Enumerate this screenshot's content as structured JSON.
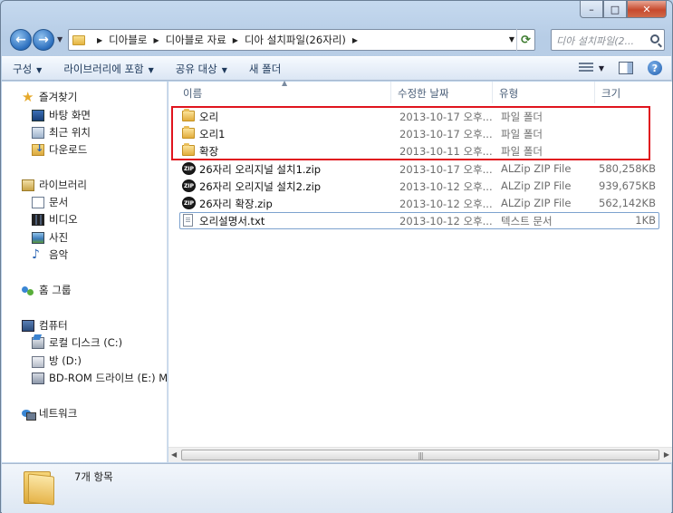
{
  "window": {
    "caption_buttons": {
      "minimize": "–",
      "maximize": "□",
      "close": "✕"
    }
  },
  "address_bar": {
    "breadcrumbs": [
      "디아블로",
      "디아블로 자료",
      "디아 설치파일(26자리)"
    ],
    "search_placeholder": "디아 설치파일(2..."
  },
  "toolbar": {
    "items": [
      {
        "label": "구성",
        "dropdown": true
      },
      {
        "label": "라이브러리에 포함",
        "dropdown": true
      },
      {
        "label": "공유 대상",
        "dropdown": true
      },
      {
        "label": "새 폴더",
        "dropdown": false
      }
    ]
  },
  "nav_pane": {
    "favorites": {
      "label": "즐겨찾기",
      "items": [
        "바탕 화면",
        "최근 위치",
        "다운로드"
      ]
    },
    "libraries": {
      "label": "라이브러리",
      "items": [
        "문서",
        "비디오",
        "사진",
        "음악"
      ]
    },
    "homegroup": {
      "label": "홈 그룹"
    },
    "computer": {
      "label": "컴퓨터",
      "items": [
        "로컬 디스크 (C:)",
        "방 (D:)",
        "BD-ROM 드라이브 (E:) M!"
      ]
    },
    "network": {
      "label": "네트워크"
    }
  },
  "columns": {
    "name": "이름",
    "modified": "수정한 날짜",
    "type": "유형",
    "size": "크기"
  },
  "files": [
    {
      "name": "오리",
      "modified": "2013-10-17 오후...",
      "type": "파일 폴더",
      "size": "",
      "icon": "folder-icon"
    },
    {
      "name": "오리1",
      "modified": "2013-10-17 오후...",
      "type": "파일 폴더",
      "size": "",
      "icon": "folder-icon"
    },
    {
      "name": "확장",
      "modified": "2013-10-11 오후...",
      "type": "파일 폴더",
      "size": "",
      "icon": "folder-icon"
    },
    {
      "name": "26자리 오리지널 설치1.zip",
      "modified": "2013-10-17 오후...",
      "type": "ALZip ZIP File",
      "size": "580,258KB",
      "icon": "zip-icon"
    },
    {
      "name": "26자리 오리지널 설치2.zip",
      "modified": "2013-10-12 오후...",
      "type": "ALZip ZIP File",
      "size": "939,675KB",
      "icon": "zip-icon"
    },
    {
      "name": "26자리 확장.zip",
      "modified": "2013-10-12 오후...",
      "type": "ALZip ZIP File",
      "size": "562,142KB",
      "icon": "zip-icon"
    },
    {
      "name": "오리설명서.txt",
      "modified": "2013-10-12 오후...",
      "type": "텍스트 문서",
      "size": "1KB",
      "icon": "txt-icon"
    }
  ],
  "zip_icon_text": "ZIP",
  "details_pane": {
    "item_count": "7개 항목"
  },
  "colors": {
    "highlight": "#e0141e"
  }
}
